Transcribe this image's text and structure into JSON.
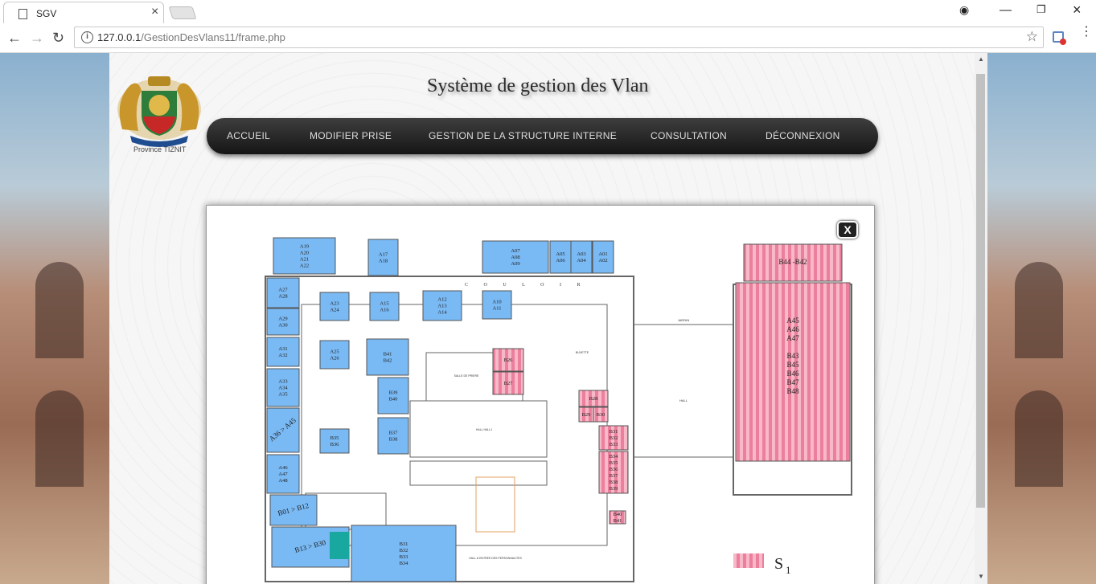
{
  "browser": {
    "tab_title": "SGV",
    "url_host": "127.0.0.1",
    "url_path": "/GestionDesVlans11/frame.php"
  },
  "header": {
    "logo_caption": "Province TIZNIT",
    "title": "Système de gestion des Vlan"
  },
  "nav": {
    "items": [
      "ACCUEIL",
      "MODIFIER PRISE",
      "GESTION DE LA STRUCTURE INTERNE",
      "CONSULTATION",
      "DÉCONNEXION"
    ]
  },
  "modal": {
    "close_label": "X",
    "legend_label": "S",
    "legend_sub": "1",
    "rooms_blue": [
      "A19\nA20\nA21\nA22",
      "A17\nA18",
      "A07\nA08\nA09",
      "A05\nA06",
      "A03\nA04",
      "A01\nA02",
      "A27\nA28",
      "A29\nA30",
      "A31\nA32",
      "A33\nA34\nA35",
      "A36 > A45",
      "A46\nA47\nA48",
      "A23\nA24",
      "A15\nA16",
      "A12\nA13\nA14",
      "A10\nA11",
      "A25\nA26",
      "B41\nB42",
      "B39\nB40",
      "B37\nB38",
      "B35\nB36",
      "B01 > B12",
      "B13 > B30",
      "B31\nB32\nB33\nB34"
    ],
    "rooms_pink": [
      "B44 -B42",
      "A45\nA46\nA47\n\nB43\nB45\nB46\nB47\nB48",
      "B26",
      "B27",
      "B28",
      "B29",
      "B30",
      "B31\nB32\nB33",
      "B34\nB35\nB36\nB37\nB38\nB39",
      "B40\nB41"
    ],
    "corridor_label": "C O U L O I R",
    "small_labels": [
      "JARDIN",
      "HALL",
      "SALLE DE PRIERE",
      "HALL HALL1",
      "BUVETTE",
      "HALL & ENTREE\nDES PERSONNALITES"
    ]
  },
  "colors": {
    "room_blue": "#79b9f4",
    "room_pink": "#f08ca6",
    "navbar": "#1f1f1f",
    "teal": "#19a8a0"
  }
}
